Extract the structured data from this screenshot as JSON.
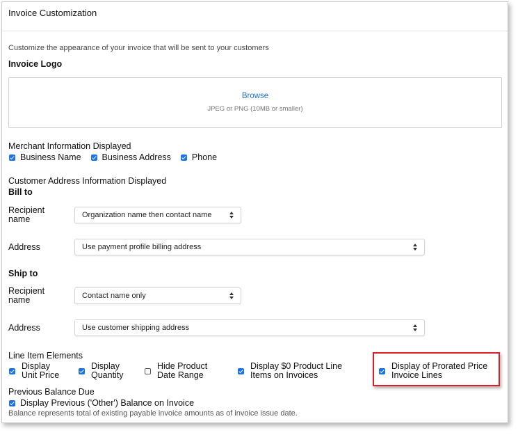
{
  "header": {
    "title": "Invoice Customization"
  },
  "intro": "Customize the appearance of your invoice that will be sent to your customers",
  "logo": {
    "title": "Invoice Logo",
    "browse_label": "Browse",
    "hint": "JPEG or PNG (10MB or smaller)"
  },
  "merchant": {
    "title": "Merchant Information Displayed",
    "options": [
      {
        "label": "Business Name",
        "checked": true
      },
      {
        "label": "Business Address",
        "checked": true
      },
      {
        "label": "Phone",
        "checked": true
      }
    ]
  },
  "customer_address": {
    "title": "Customer Address Information Displayed",
    "bill_to": {
      "title": "Bill to",
      "recipient_label_1": "Recipient",
      "recipient_label_2": "name",
      "recipient_value": "Organization name then contact name",
      "address_label": "Address",
      "address_value": "Use payment profile billing address"
    },
    "ship_to": {
      "title": "Ship to",
      "recipient_label_1": "Recipient",
      "recipient_label_2": "name",
      "recipient_value": "Contact name only",
      "address_label": "Address",
      "address_value": "Use customer shipping address"
    }
  },
  "line_items": {
    "title": "Line Item Elements",
    "options": [
      {
        "line1": "Display",
        "line2": "Unit Price",
        "checked": true
      },
      {
        "line1": "Display",
        "line2": "Quantity",
        "checked": true
      },
      {
        "line1": "Hide Product",
        "line2": "Date Range",
        "checked": false
      },
      {
        "line1": "Display $0 Product Line",
        "line2": "Items on Invoices",
        "checked": true
      },
      {
        "line1": "Display of Prorated Price",
        "line2": "Invoice Lines",
        "checked": true
      }
    ]
  },
  "previous_balance": {
    "title": "Previous Balance Due",
    "option_label": "Display Previous ('Other') Balance on Invoice",
    "checked": true,
    "note": "Balance represents total of existing payable invoice amounts as of invoice issue date."
  },
  "colors": {
    "accent": "#1a73e8",
    "link": "#1a73c8",
    "highlight": "#d92027"
  }
}
